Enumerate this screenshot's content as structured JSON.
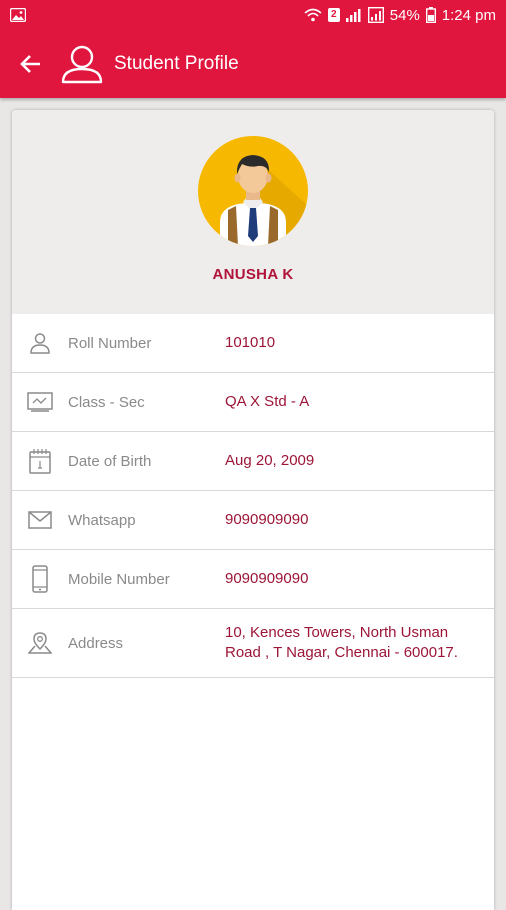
{
  "status_bar": {
    "battery_percent": "54%",
    "time": "1:24 pm",
    "sim_badge": "2"
  },
  "app_bar": {
    "title": "Student Profile"
  },
  "profile": {
    "name": "ANUSHA K"
  },
  "fields": [
    {
      "label": "Roll Number",
      "value": "101010",
      "icon": "person-icon"
    },
    {
      "label": "Class - Sec",
      "value": "QA X Std - A",
      "icon": "classroom-board-icon"
    },
    {
      "label": "Date of Birth",
      "value": "Aug 20, 2009",
      "icon": "calendar-icon"
    },
    {
      "label": "Whatsapp",
      "value": "9090909090",
      "icon": "envelope-icon"
    },
    {
      "label": "Mobile Number",
      "value": "9090909090",
      "icon": "mobile-phone-icon"
    },
    {
      "label": "Address",
      "value": "10, Kences Towers, North Usman Road , T Nagar, Chennai - 600017.",
      "icon": "location-pin-icon"
    }
  ],
  "colors": {
    "primary": "#e0163f",
    "accent_text": "#9c1537",
    "label_text": "#8a8a8a",
    "header_bg": "#efedec",
    "avatar_bg": "#f6b800"
  }
}
